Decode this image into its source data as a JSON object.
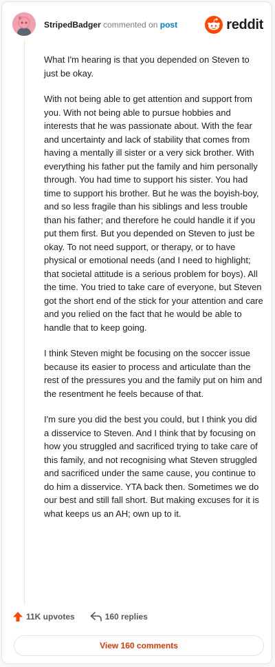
{
  "header": {
    "username": "StripedBadger",
    "commented_text": "commented on",
    "post_link": "post",
    "logo_text": "reddit"
  },
  "comment": {
    "paragraphs": [
      "What I'm hearing is that you depended on Steven to just be okay.",
      "With not being able to get attention and support from you. With not being able to pursue hobbies and interests that he was passionate about. With the fear and uncertainty and lack of stability that comes from having a mentally ill sister or a very sick brother. With everything his father put the family and him personally through. You had time to support his sister. You had time to support his brother. But he was the boyish-boy, and so less fragile than his siblings and less trouble than his father; and therefore he could handle it if you put them first. But you depended on Steven to just be okay. To not need support, or therapy, or to have physical or emotional needs (and I need to highlight; that societal attitude is a serious problem for boys). All the time. You tried to take care of everyone, but Steven got the short end of the stick for your attention and care and you relied on the fact that he would be able to handle that to keep going.",
      "I think Steven might be focusing on the soccer issue because its easier to process and articulate than the rest of the pressures you and the family put on him and the resentment he feels because of that.",
      "I'm sure you did the best you could, but I think you did a disservice to Steven. And I think that by focusing on how you struggled and sacrificed trying to take care of this family, and not recognising what Steven struggled and sacrificed under the same cause, you continue to do him a disservice. YTA back then. Sometimes we do our best and still fall short. But making excuses for it is what keeps us an AH; own up to it."
    ]
  },
  "actions": {
    "upvotes": "11K upvotes",
    "replies": "160 replies",
    "view_comments": "View 160 comments"
  },
  "colors": {
    "accent_orange": "#ff4500",
    "link_blue": "#0079d3",
    "view_button_text": "#d93a00",
    "avatar_pink": "#f2a0ad"
  },
  "icons": {
    "avatar": "snoo-avatar",
    "logo": "reddit-snoo-icon",
    "upvote": "upvote-arrow-icon",
    "reply": "reply-arrow-icon"
  }
}
